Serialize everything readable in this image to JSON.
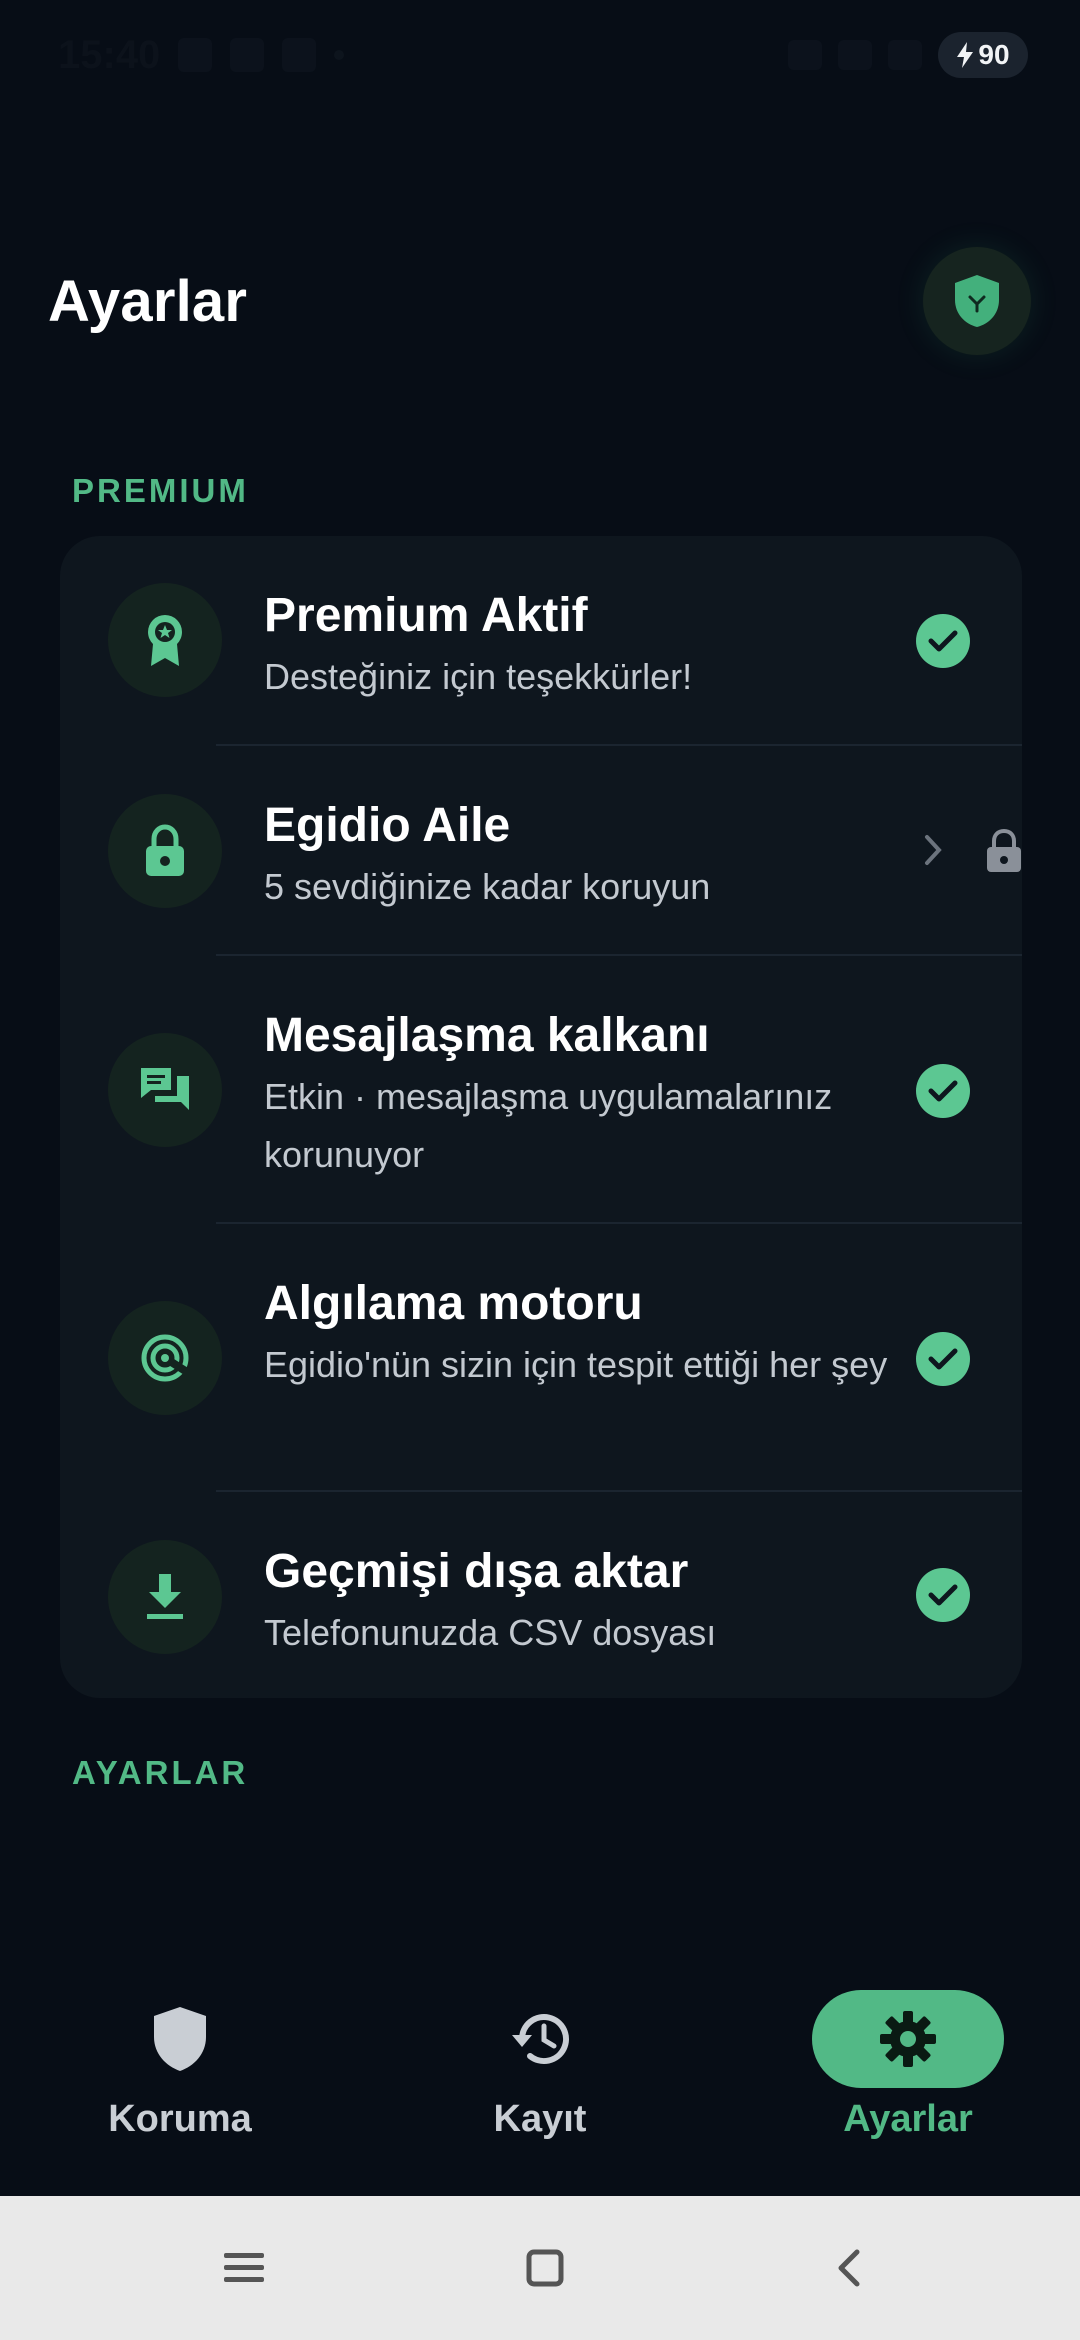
{
  "status_bar": {
    "time": "15:40",
    "battery": "90"
  },
  "header": {
    "title": "Ayarlar"
  },
  "sections": {
    "premium_label": "PREMIUM",
    "settings_label": "AYARLAR"
  },
  "items": [
    {
      "title": "Premium Aktif",
      "subtitle": "Desteğiniz için teşekkürler!",
      "icon": "award-icon",
      "trailing": "check"
    },
    {
      "title": "Egidio Aile",
      "subtitle": "5 sevdiğinize kadar koruyun",
      "icon": "lock-icon",
      "trailing": "chevron-lock"
    },
    {
      "title": "Mesajlaşma kalkanı",
      "subtitle": "Etkin · mesajlaşma uygulamalarınız korunuyor",
      "icon": "chat-icon",
      "trailing": "check"
    },
    {
      "title": "Algılama motoru",
      "subtitle": "Egidio'nün sizin için tespit ettiği her şey",
      "icon": "target-icon",
      "trailing": "check"
    },
    {
      "title": "Geçmişi dışa aktar",
      "subtitle": "Telefonunuzda CSV dosyası",
      "icon": "download-icon",
      "trailing": "check"
    }
  ],
  "bottom_nav": {
    "items": [
      {
        "label": "Koruma",
        "icon": "shield-icon",
        "active": false
      },
      {
        "label": "Kayıt",
        "icon": "history-icon",
        "active": false
      },
      {
        "label": "Ayarlar",
        "icon": "gear-icon",
        "active": true
      }
    ]
  },
  "colors": {
    "background": "#070d16",
    "card": "#0e161e",
    "accent": "#52b986",
    "check": "#5cc792"
  }
}
